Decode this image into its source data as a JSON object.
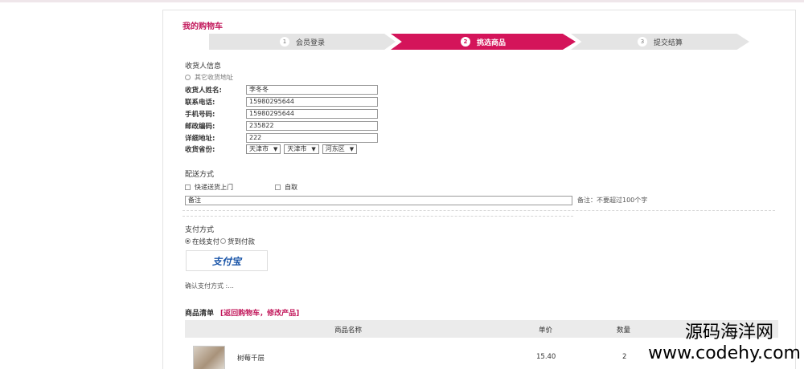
{
  "page": {
    "title": "我的购物车"
  },
  "steps": [
    {
      "num": "1",
      "label": "会员登录"
    },
    {
      "num": "2",
      "label": "挑选商品"
    },
    {
      "num": "3",
      "label": "提交结算"
    }
  ],
  "receiver": {
    "section_title": "收货人信息",
    "other_address": "其它收货地址",
    "fields": {
      "name": {
        "label": "收货人姓名:",
        "value": "李冬冬"
      },
      "phone": {
        "label": "联系电话:",
        "value": "15980295644"
      },
      "mobile": {
        "label": "手机号码:",
        "value": "15980295644"
      },
      "zip": {
        "label": "邮政编码:",
        "value": "235822"
      },
      "address": {
        "label": "详细地址:",
        "value": "222"
      },
      "province": {
        "label": "收货省份:"
      }
    },
    "selects": [
      "天津市",
      "天津市",
      "河东区"
    ]
  },
  "delivery": {
    "section_title": "配送方式",
    "options": [
      "快递送货上门",
      "自取"
    ],
    "remark_placeholder": "备注",
    "remark_hint": "备注：不要超过100个字"
  },
  "payment": {
    "section_title": "支付方式",
    "options": [
      "在线支付",
      "货到付款"
    ],
    "logo_text": "支付宝",
    "confirm_text": "确认支付方式 :..."
  },
  "goods": {
    "section_title": "商品清单",
    "links": "[返回购物车，修改产品]",
    "columns": [
      "商品名称",
      "单价",
      "数量"
    ],
    "rows": [
      {
        "name": "树莓千层",
        "price": "15.40",
        "qty": "2"
      }
    ]
  },
  "watermark": {
    "line1": "源码海洋网",
    "line2": "www.codehy.com"
  },
  "colors": {
    "accent": "#d4145a",
    "title": "#c2185b"
  }
}
